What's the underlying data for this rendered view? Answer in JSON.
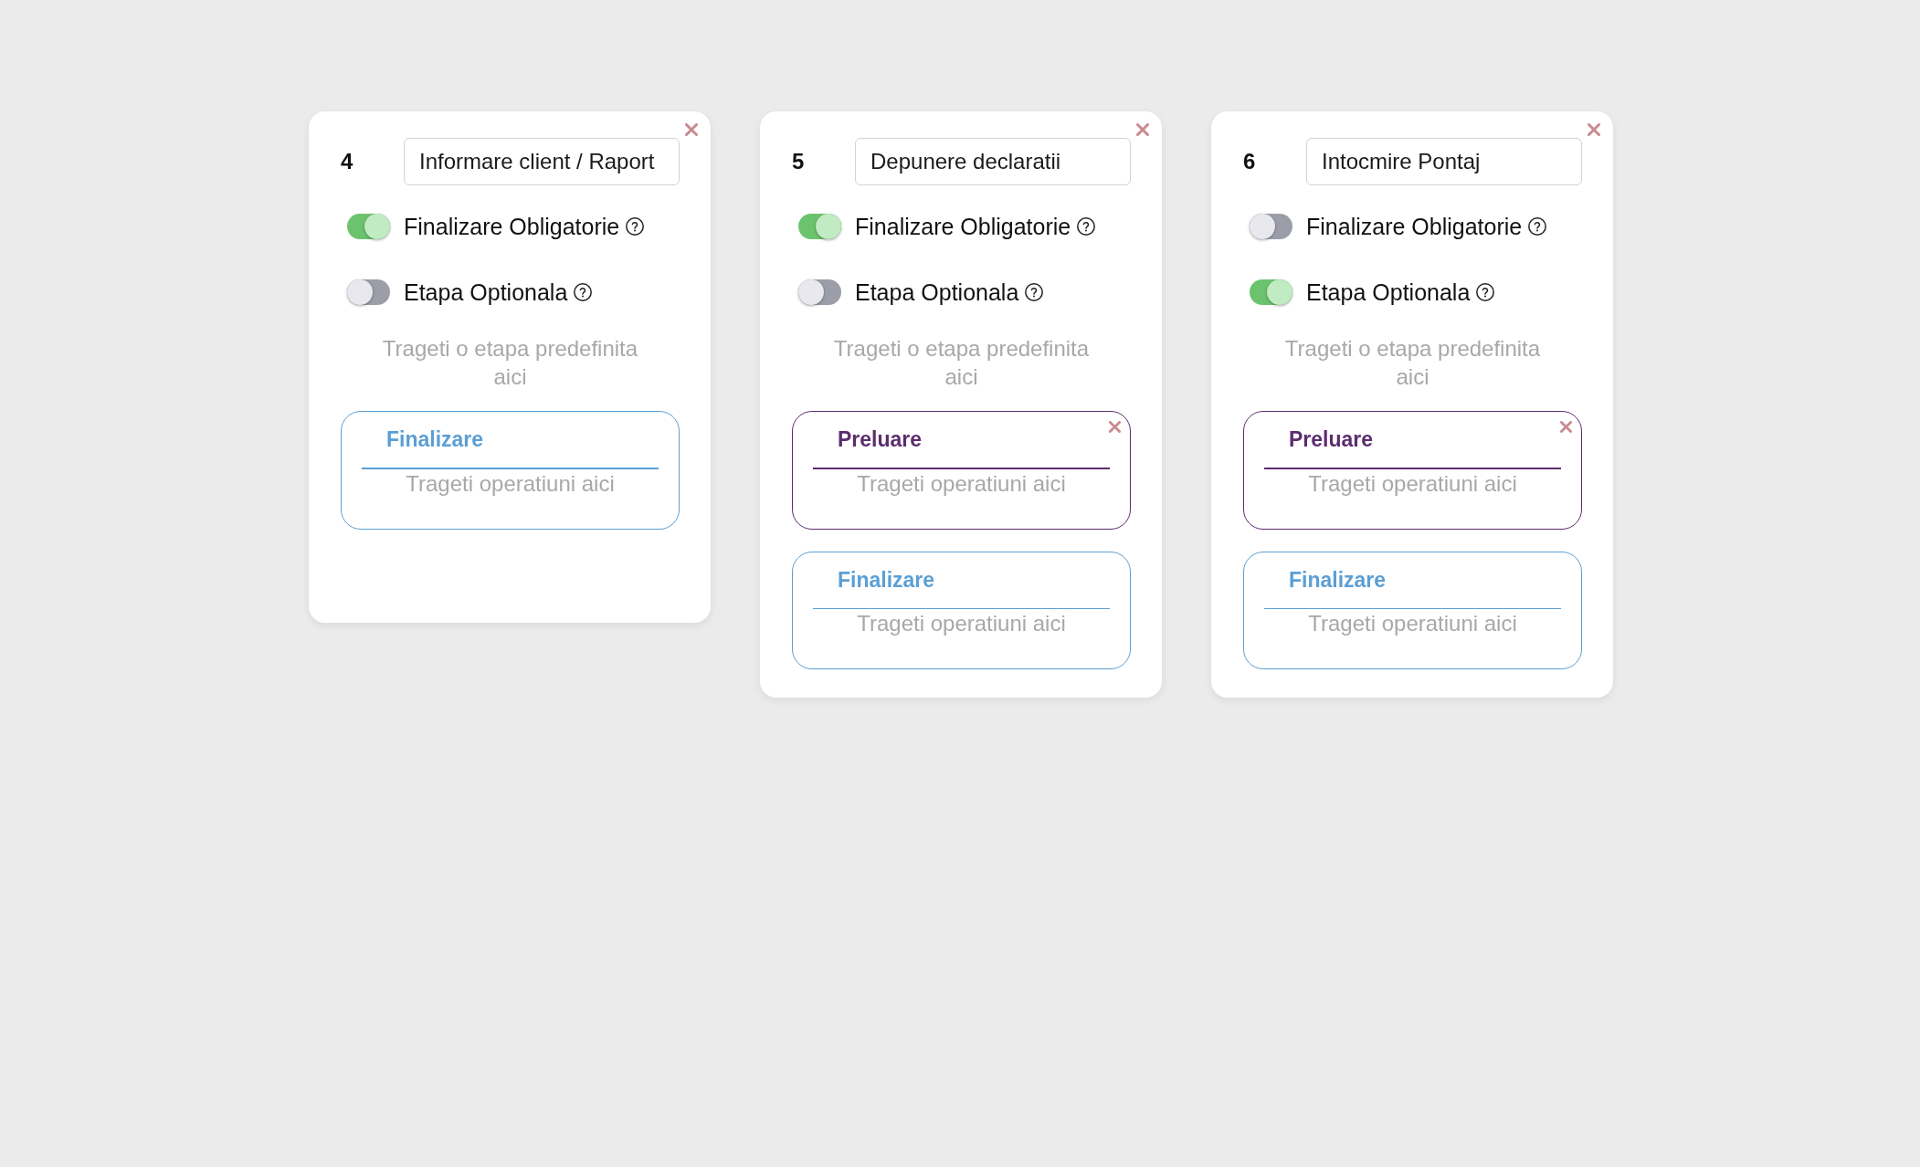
{
  "cards": [
    {
      "number": "4",
      "name": "Informare client / Raport",
      "toggles": [
        {
          "label": "Finalizare Obligatorie",
          "on": true
        },
        {
          "label": "Etapa Optionala",
          "on": false
        }
      ],
      "hint": "Trageti o etapa predefinita aici",
      "stages": [
        {
          "title": "Finalizare",
          "color": "#5b9fd5",
          "removable": false,
          "hint": "Trageti operatiuni aici"
        }
      ]
    },
    {
      "number": "5",
      "name": "Depunere declaratii",
      "toggles": [
        {
          "label": "Finalizare Obligatorie",
          "on": true
        },
        {
          "label": "Etapa Optionala",
          "on": false
        }
      ],
      "hint": "Trageti o etapa predefinita aici",
      "stages": [
        {
          "title": "Preluare",
          "color": "#5c2d6e",
          "removable": true,
          "hint": "Trageti operatiuni aici"
        },
        {
          "title": "Finalizare",
          "color": "#5b9fd5",
          "removable": false,
          "hint": "Trageti operatiuni aici"
        }
      ]
    },
    {
      "number": "6",
      "name": "Intocmire Pontaj",
      "toggles": [
        {
          "label": "Finalizare Obligatorie",
          "on": false
        },
        {
          "label": "Etapa Optionala",
          "on": true
        }
      ],
      "hint": "Trageti o etapa predefinita aici",
      "stages": [
        {
          "title": "Preluare",
          "color": "#5c2d6e",
          "removable": true,
          "hint": "Trageti operatiuni aici"
        },
        {
          "title": "Finalizare",
          "color": "#5b9fd5",
          "removable": false,
          "hint": "Trageti operatiuni aici"
        }
      ]
    }
  ]
}
